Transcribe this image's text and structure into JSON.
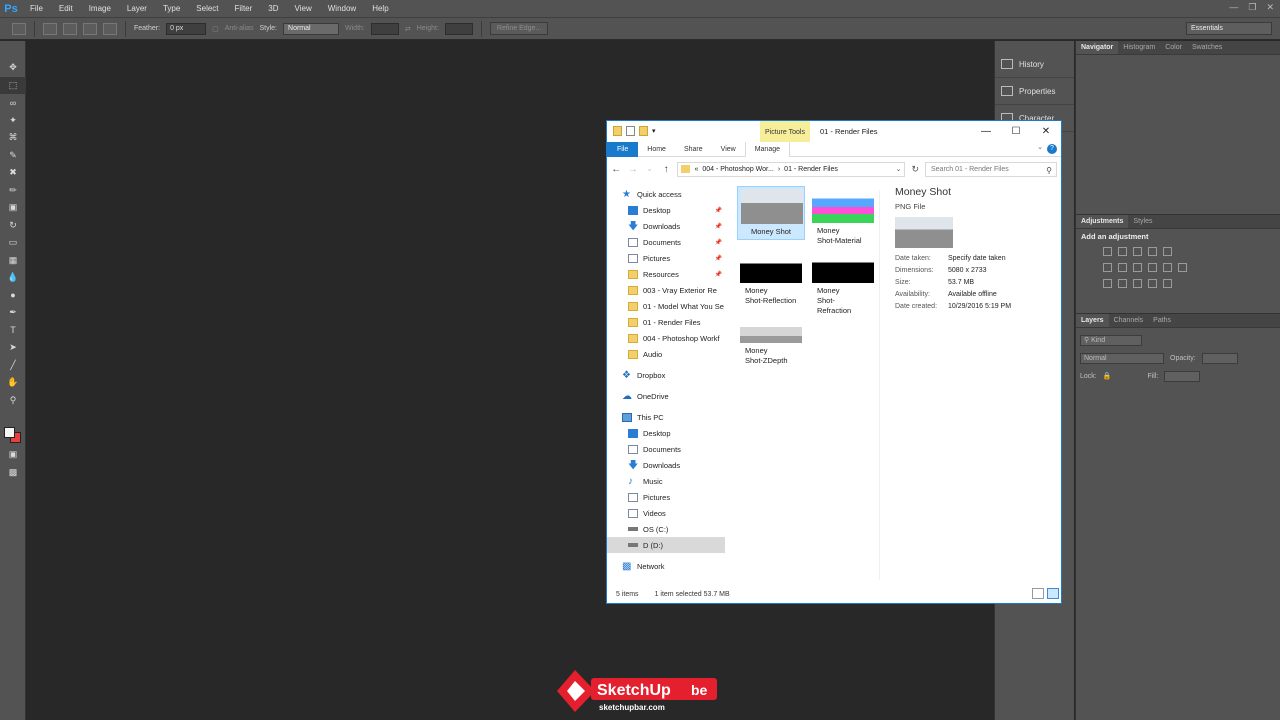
{
  "ps": {
    "logo": "Ps",
    "menu": [
      "File",
      "Edit",
      "Image",
      "Layer",
      "Type",
      "Select",
      "Filter",
      "3D",
      "View",
      "Window",
      "Help"
    ],
    "options": {
      "feather_label": "Feather:",
      "feather_value": "0 px",
      "antialias_label": "Anti-alias",
      "style_label": "Style:",
      "style_value": "Normal",
      "width_label": "Width:",
      "height_label": "Height:",
      "refine_label": "Refine Edge...",
      "workspace": "Essentials"
    },
    "dock": {
      "history": "History",
      "properties": "Properties",
      "character": "Character"
    },
    "panels": {
      "top_tabs": [
        "Navigator",
        "Histogram",
        "Color",
        "Swatches"
      ],
      "mid_tabs": [
        "Adjustments",
        "Styles"
      ],
      "add_adjustment": "Add an adjustment",
      "layer_tabs": [
        "Layers",
        "Channels",
        "Paths"
      ],
      "kind": "Kind",
      "blend": "Normal",
      "opacity_label": "Opacity:",
      "lock_label": "Lock:",
      "fill_label": "Fill:"
    },
    "colors": {
      "foreground": "#f6f6f6",
      "background": "#e8403e"
    }
  },
  "explorer": {
    "context_tab": "Picture Tools",
    "title": "01 - Render Files",
    "ribbon": [
      "File",
      "Home",
      "Share",
      "View",
      "Manage"
    ],
    "address": {
      "prefix": "«",
      "crumb1": "004 - Photoshop Wor...",
      "sep": "›",
      "crumb2": "01 - Render Files"
    },
    "search_placeholder": "Search 01 - Render Files",
    "nav": {
      "quick_access": "Quick access",
      "quick_items": [
        "Desktop",
        "Downloads",
        "Documents",
        "Pictures",
        "Resources",
        "003 - Vray Exterior Re",
        "01 - Model What You Se",
        "01 - Render Files",
        "004 - Photoshop Workf",
        "Audio"
      ],
      "dropbox": "Dropbox",
      "onedrive": "OneDrive",
      "this_pc": "This PC",
      "pc_items": [
        "Desktop",
        "Documents",
        "Downloads",
        "Music",
        "Pictures",
        "Videos",
        "OS (C:)",
        "D (D:)"
      ],
      "network": "Network"
    },
    "files": [
      {
        "line1": "Money Shot",
        "line2": ""
      },
      {
        "line1": "Money",
        "line2": "Shot-Material ID"
      },
      {
        "line1": "Money",
        "line2": "Shot-Reflection"
      },
      {
        "line1": "Money",
        "line2": "Shot-Refraction"
      },
      {
        "line1": "Money",
        "line2": "Shot-ZDepth"
      }
    ],
    "details": {
      "name": "Money Shot",
      "type": "PNG File",
      "rows": [
        {
          "k": "Date taken:",
          "v": "Specify date taken"
        },
        {
          "k": "Dimensions:",
          "v": "5080 x 2733"
        },
        {
          "k": "Size:",
          "v": "53.7 MB"
        },
        {
          "k": "Availability:",
          "v": "Available offline"
        },
        {
          "k": "Date created:",
          "v": "10/29/2016 5:19 PM"
        }
      ]
    },
    "status": {
      "count": "5 items",
      "selected": "1 item selected  53.7 MB"
    }
  },
  "watermark": {
    "brand": "SketchUp",
    "suffix": "be",
    "url": "sketchupbar.com"
  }
}
